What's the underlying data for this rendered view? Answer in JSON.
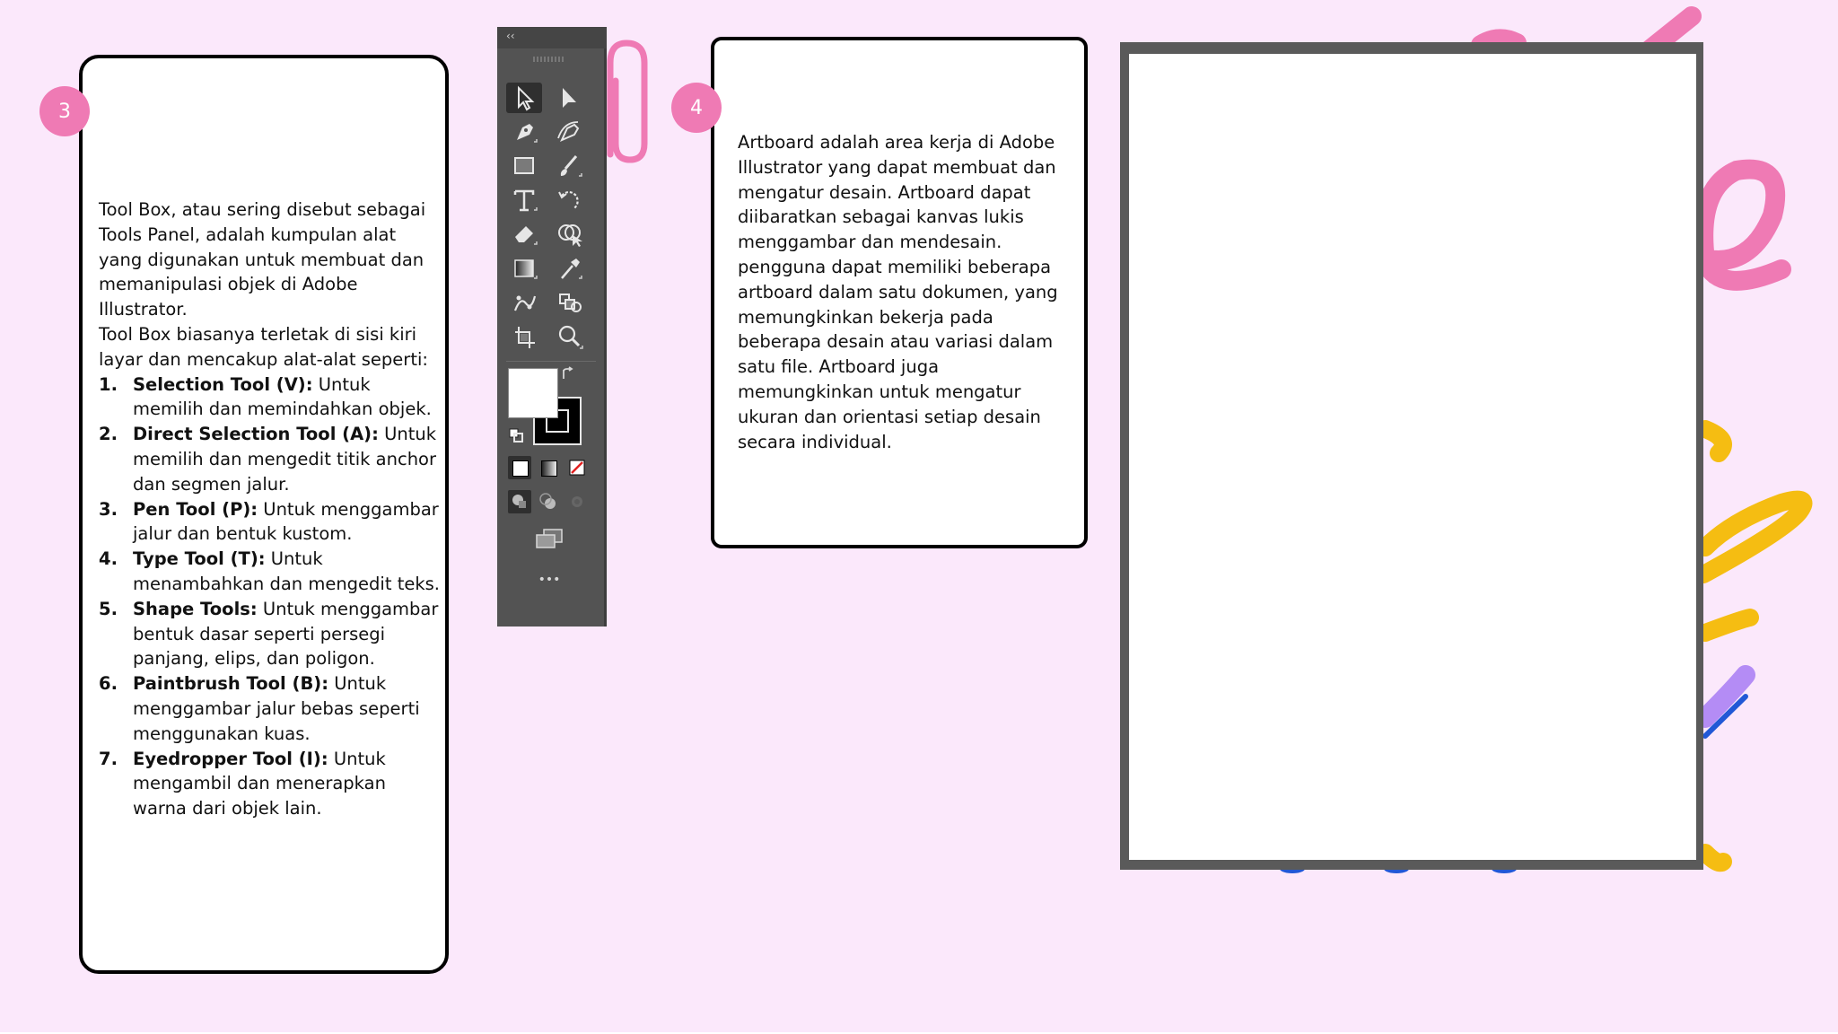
{
  "slide": {
    "background": "#fbe8fb",
    "accent_pink": "#ef7ab4",
    "accent_yellow": "#f5bd12",
    "accent_purple": "#b48cf5",
    "accent_blue": "#2158d6"
  },
  "card_left": {
    "badge": "3",
    "intro_1": "Tool Box, atau sering disebut sebagai Tools Panel, adalah kumpulan alat yang digunakan untuk membuat dan memanipulasi objek di Adobe Illustrator.",
    "intro_2": "Tool Box biasanya terletak di sisi kiri layar dan mencakup alat-alat seperti:",
    "items": [
      {
        "num": "1.",
        "name": "Selection Tool (V):",
        "desc": " Untuk memilih dan memindahkan objek."
      },
      {
        "num": "2.",
        "name": "Direct Selection Tool (A):",
        "desc": " Untuk memilih dan mengedit titik anchor dan segmen jalur."
      },
      {
        "num": "3.",
        "name": "Pen Tool (P):",
        "desc": " Untuk menggambar jalur dan bentuk kustom."
      },
      {
        "num": "4.",
        "name": "Type Tool (T):",
        "desc": " Untuk menambahkan dan mengedit teks."
      },
      {
        "num": "5.",
        "name": "Shape Tools:",
        "desc": " Untuk menggambar bentuk dasar seperti persegi panjang, elips, dan poligon."
      },
      {
        "num": "6.",
        "name": "Paintbrush Tool (B):",
        "desc": " Untuk menggambar jalur bebas seperti menggunakan kuas."
      },
      {
        "num": "7.",
        "name": "Eyedropper Tool (I):",
        "desc": " Untuk mengambil dan menerapkan warna dari objek lain."
      }
    ]
  },
  "card_middle": {
    "badge": "4",
    "text": "Artboard adalah area kerja di Adobe Illustrator yang dapat membuat dan mengatur desain. Artboard dapat diibaratkan sebagai kanvas lukis menggambar dan mendesain. pengguna dapat memiliki beberapa artboard dalam satu dokumen, yang memungkinkan bekerja pada beberapa desain atau variasi dalam satu file. Artboard juga memungkinkan untuk  mengatur ukuran dan orientasi setiap desain secara individual."
  },
  "toolbox": {
    "collapse_label": "‹‹",
    "more_label": "•••",
    "tools": [
      {
        "name": "selection-tool",
        "icon": "selection-arrow-icon"
      },
      {
        "name": "direct-selection-tool",
        "icon": "direct-selection-arrow-icon"
      },
      {
        "name": "pen-tool",
        "icon": "pen-icon"
      },
      {
        "name": "curvature-tool",
        "icon": "curvature-pen-icon"
      },
      {
        "name": "rectangle-tool",
        "icon": "rectangle-icon"
      },
      {
        "name": "paintbrush-tool",
        "icon": "paintbrush-icon"
      },
      {
        "name": "type-tool",
        "icon": "type-t-icon"
      },
      {
        "name": "rotate-tool",
        "icon": "rotate-icon"
      },
      {
        "name": "eraser-tool",
        "icon": "eraser-icon"
      },
      {
        "name": "shape-builder-tool",
        "icon": "shape-builder-icon"
      },
      {
        "name": "gradient-tool",
        "icon": "gradient-icon"
      },
      {
        "name": "eyedropper-tool",
        "icon": "eyedropper-icon"
      },
      {
        "name": "puppet-warp-tool",
        "icon": "puppet-warp-icon"
      },
      {
        "name": "symbol-sprayer-tool",
        "icon": "symbol-sprayer-icon"
      },
      {
        "name": "artboard-tool",
        "icon": "artboard-crop-icon"
      },
      {
        "name": "zoom-tool",
        "icon": "zoom-icon"
      }
    ],
    "fill_color": "#ffffff",
    "stroke_color": "#000000"
  }
}
